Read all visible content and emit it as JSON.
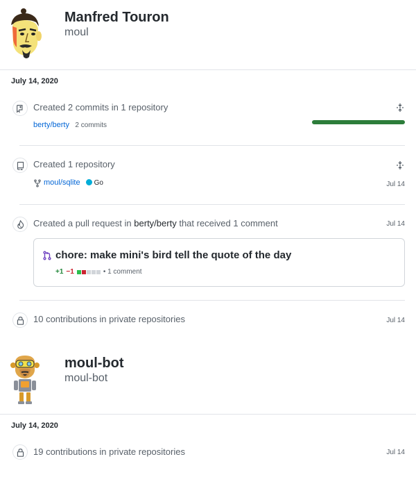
{
  "users": [
    {
      "name": "Manfred Touron",
      "login": "moul",
      "date": "July 14, 2020",
      "events": {
        "commits": {
          "title": "Created 2 commits in 1 repository",
          "repo": "berty/berty",
          "count": "2 commits"
        },
        "repo_created": {
          "title": "Created 1 repository",
          "repo": "moul/sqlite",
          "language": "Go",
          "date": "Jul 14"
        },
        "pull_request": {
          "title_prefix": "Created a pull request in",
          "repo": "berty/berty",
          "title_suffix": "that received 1 comment",
          "date": "Jul 14",
          "pr_title": "chore: make mini's bird tell the quote of the day",
          "additions": "+1",
          "deletions": "−1",
          "comments": "• 1 comment"
        },
        "private": {
          "title": "10 contributions in private repositories",
          "date": "Jul 14"
        }
      }
    },
    {
      "name": "moul-bot",
      "login": "moul-bot",
      "date": "July 14, 2020",
      "events": {
        "private": {
          "title": "19 contributions in private repositories",
          "date": "Jul 14"
        }
      }
    }
  ],
  "colors": {
    "accent_link": "#0366d6",
    "progress_green": "#2c7d3a",
    "go_language": "#00ADD8",
    "additions": "#22863a",
    "deletions": "#cb2431",
    "pr_icon": "#6f42c1"
  },
  "icons": {
    "commits": "repo-push-icon",
    "repo": "repo-icon",
    "fork": "repo-forked-icon",
    "pr": "flame-icon",
    "private": "lock-icon",
    "fold": "fold-icon",
    "pull_request": "git-pull-request-icon"
  }
}
